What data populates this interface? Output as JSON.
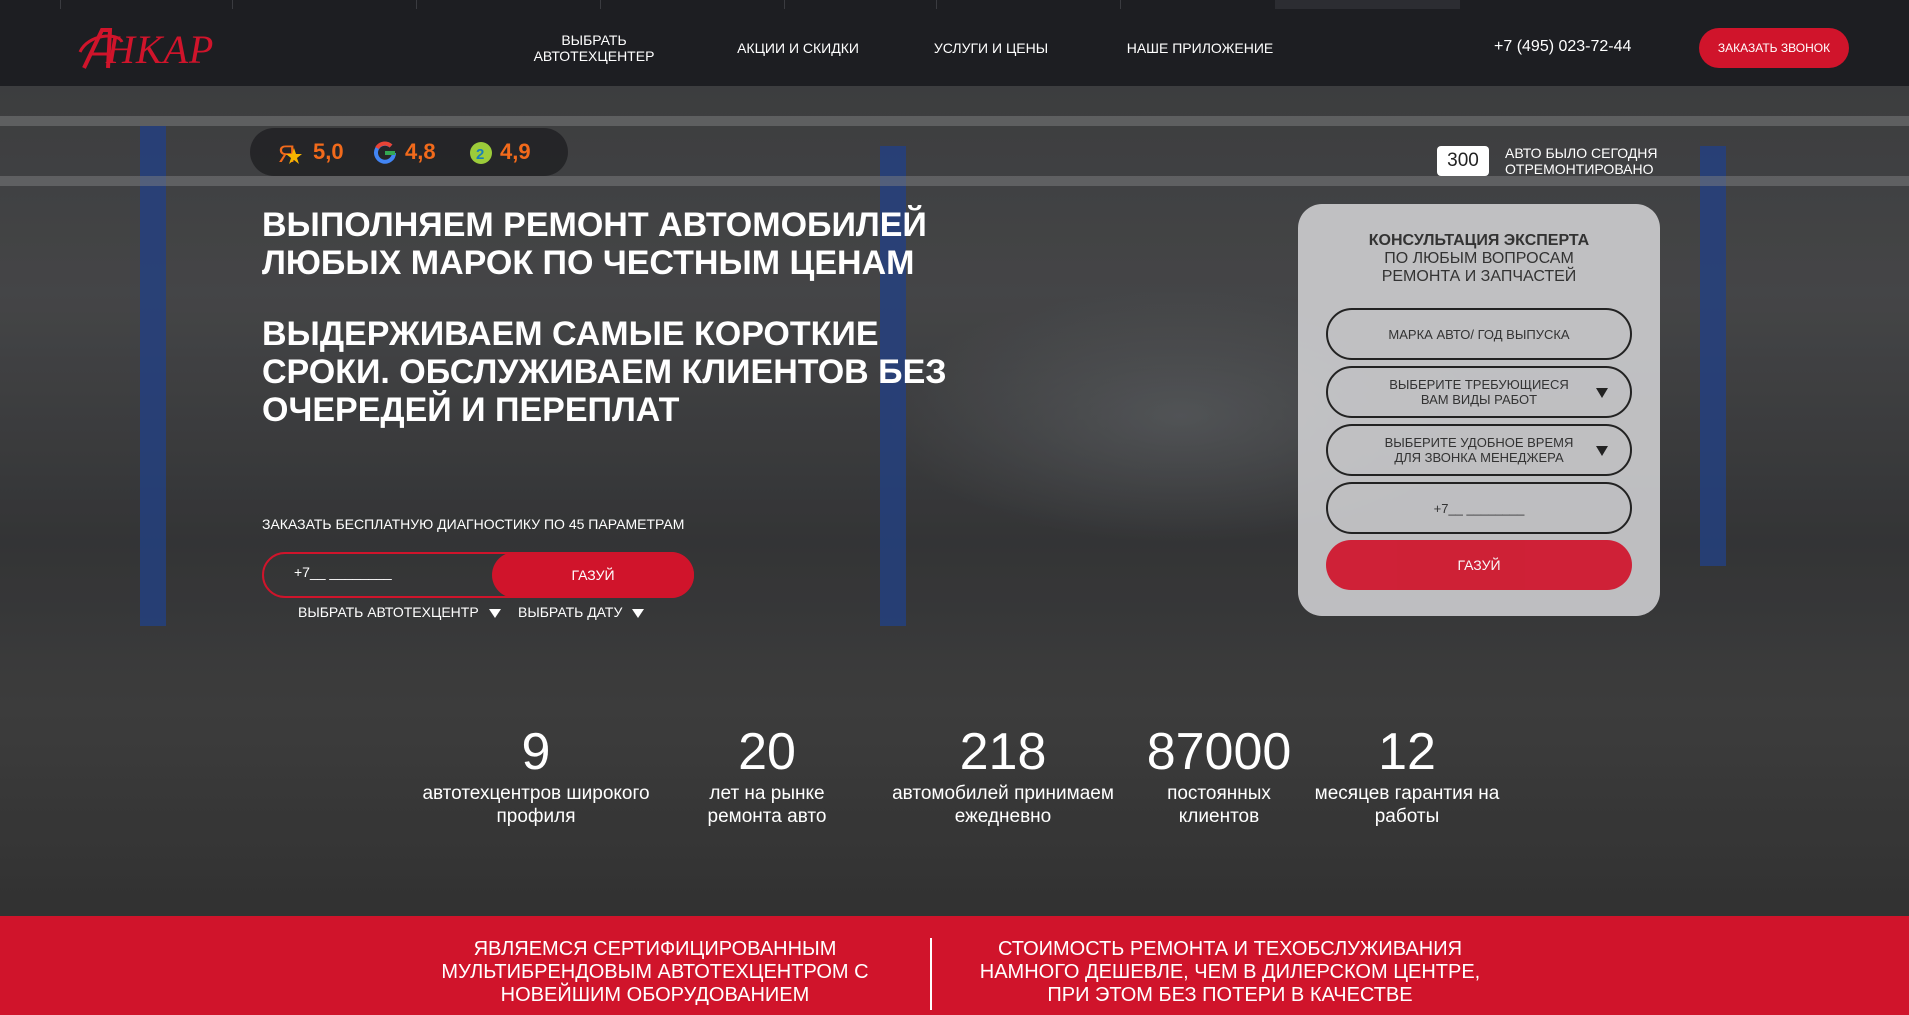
{
  "header": {
    "logo_text": "НКАР",
    "nav": [
      "ВЫБРАТЬ АВТОТЕХЦЕНТЕР",
      "АКЦИИ И СКИДКИ",
      "УСЛУГИ И ЦЕНЫ",
      "НАШЕ ПРИЛОЖЕНИЕ"
    ],
    "phone": "+7 (495) 023-72-44",
    "call_button": "ЗАКАЗАТЬ ЗВОНОК"
  },
  "ratings": [
    {
      "icon": "yandex-icon",
      "value": "5,0"
    },
    {
      "icon": "google-icon",
      "value": "4,8"
    },
    {
      "icon": "2gis-icon",
      "value": "4,9"
    }
  ],
  "hero": {
    "headline": "ВЫПОЛНЯЕМ РЕМОНТ АВТОМОБИЛЕЙ ЛЮБЫХ МАРОК ПО ЧЕСТНЫМ ЦЕНАМ",
    "subheadline": "ВЫДЕРЖИВАЕМ САМЫЕ КОРОТКИЕ СРОКИ. ОБСЛУЖИВАЕМ КЛИЕНТОВ БЕЗ ОЧЕРЕДЕЙ И ПЕРЕПЛАТ",
    "diagnostics_label": "ЗАКАЗАТЬ БЕСПЛАТНУЮ ДИАГНОСТИКУ ПО 45 ПАРАМЕТРАМ",
    "phone_placeholder": "+7__ ________",
    "submit": "ГАЗУЙ",
    "select_center": "ВЫБРАТЬ АВТОТЕХЦЕНТР",
    "select_date": "ВЫБРАТЬ ДАТУ"
  },
  "counter": {
    "value": "300",
    "label": "АВТО БЫЛО СЕГОДНЯ ОТРЕМОНТИРОВАНО"
  },
  "consult": {
    "title_bold": "КОНСУЛЬТАЦИЯ ЭКСПЕРТА",
    "title_rest": "ПО ЛЮБЫМ ВОПРОСАМ РЕМОНТА И ЗАПЧАСТЕЙ",
    "car_field": "МАРКА АВТО/ ГОД ВЫПУСКА",
    "works_select": "ВЫБЕРИТЕ ТРЕБУЮЩИЕСЯ ВАМ ВИДЫ РАБОТ",
    "time_select": "ВЫБЕРИТЕ УДОБНОЕ ВРЕМЯ ДЛЯ ЗВОНКА МЕНЕДЖЕРА",
    "phone_placeholder": "+7__ ________",
    "submit": "ГАЗУЙ"
  },
  "stats": [
    {
      "number": "9",
      "label": "автотехцентров широкого профиля"
    },
    {
      "number": "20",
      "label": "лет на рынке ремонта авто"
    },
    {
      "number": "218",
      "label": "автомобилей принимаем ежедневно"
    },
    {
      "number": "87000",
      "label": "постоянных клиентов"
    },
    {
      "number": "12",
      "label": "месяцев гарантия на работы"
    }
  ],
  "band": {
    "left": "ЯВЛЯЕМСЯ СЕРТИФИЦИРОВАННЫМ МУЛЬТИБРЕНДОВЫМ АВТОТЕХЦЕНТРОМ С НОВЕЙШИМ ОБОРУДОВАНИЕМ",
    "right": "СТОИМОСТЬ РЕМОНТА И ТЕХОБСЛУЖИВАНИЯ НАМНОГО ДЕШЕВЛЕ, ЧЕМ В ДИЛЕРСКОМ ЦЕНТРЕ, ПРИ ЭТОМ БЕЗ ПОТЕРИ В КАЧЕСТВЕ"
  },
  "colors": {
    "accent": "#d0142b",
    "header_bg": "#1d1e22",
    "rating": "#f26a1b"
  }
}
